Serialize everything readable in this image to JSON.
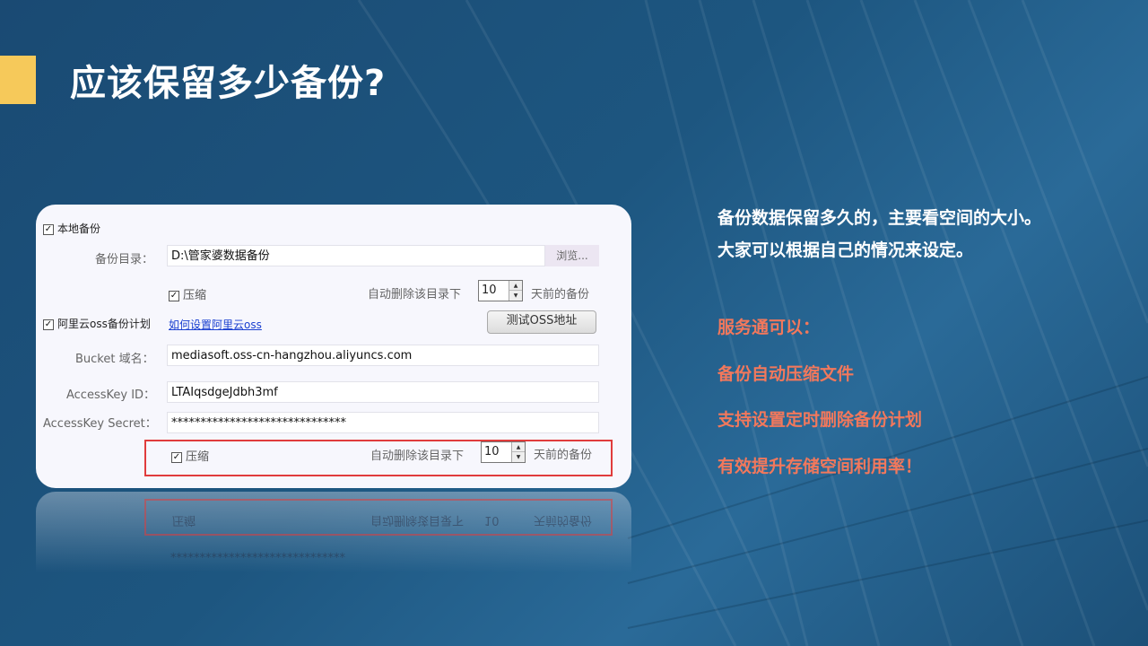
{
  "slide": {
    "title": "应该保留多少备份?",
    "accent_color": "#f6c95a"
  },
  "panel": {
    "local_backup_label": "本地备份",
    "local_backup_checked": "✓",
    "backup_dir_label": "备份目录：",
    "backup_dir_value": "D:\\管家婆数据备份",
    "browse_label": "浏览...",
    "compress_label": "压缩",
    "compress_checked": "✓",
    "auto_delete_prefix": "自动删除该目录下",
    "auto_delete_days": "10",
    "auto_delete_suffix": "天前的备份",
    "oss_plan_label": "阿里云oss备份计划",
    "oss_plan_checked": "✓",
    "oss_howto_link": "如何设置阿里云oss",
    "test_oss_button": "测试OSS地址",
    "bucket_label": "Bucket 域名：",
    "bucket_value": "mediasoft.oss-cn-hangzhou.aliyuncs.com",
    "access_key_id_label": "AccessKey ID：",
    "access_key_id_value": "LTAIqsdgeJdbh3mf",
    "access_key_secret_label": "AccessKey Secret：",
    "access_key_secret_value": "******************************",
    "oss_compress_label": "压缩",
    "oss_compress_checked": "✓",
    "oss_auto_delete_prefix": "自动删除该目录下",
    "oss_auto_delete_days": "10",
    "oss_auto_delete_suffix": "天前的备份",
    "highlight_color": "#e03c3c"
  },
  "side": {
    "line1": "备份数据保留多久的，主要看空间的大小。",
    "line2": "大家可以根据自己的情况来设定。",
    "service_heading": "服务通可以：",
    "point1": "备份自动压缩文件",
    "point2": "支持设置定时删除备份计划",
    "point3": "有效提升存储空间利用率！",
    "highlight_color": "#f2785c"
  }
}
